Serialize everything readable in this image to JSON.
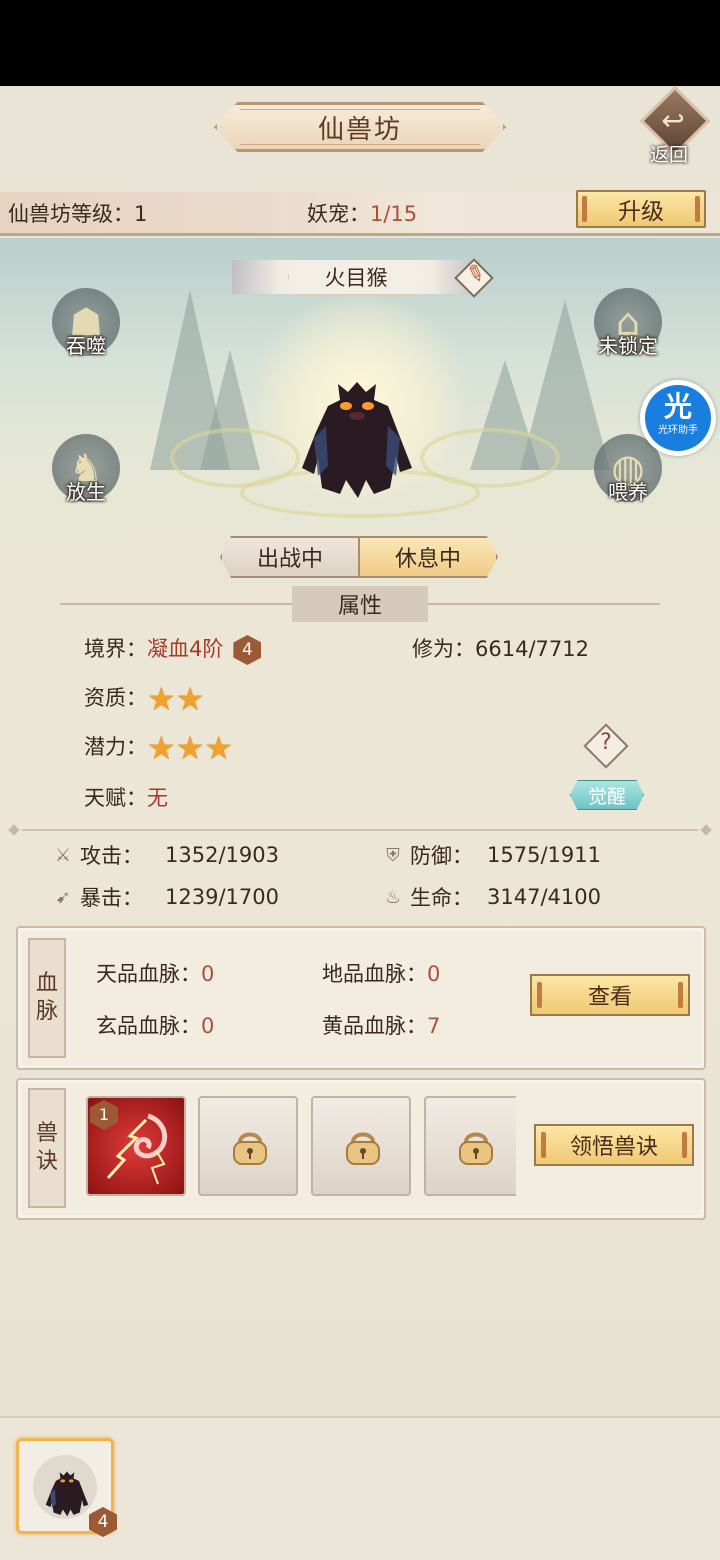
{
  "header": {
    "title": "仙兽坊",
    "back_label": "返回"
  },
  "info": {
    "level_label": "仙兽坊等级：1",
    "pet_label": "妖宠：",
    "pet_value": "1/15",
    "upgrade_label": "升级"
  },
  "pet": {
    "name": "火目猴",
    "actions": {
      "devour": "吞噬",
      "release": "放生",
      "lock": "未锁定",
      "feed": "喂养"
    },
    "status": {
      "battle": "出战中",
      "resting": "休息中",
      "selected": "休息中"
    }
  },
  "helper": {
    "big": "光",
    "small": "光环助手"
  },
  "attributes": {
    "section_title": "属性",
    "realm_label": "境界：",
    "realm_value": "凝血4阶",
    "realm_badge": "4",
    "cultivation_label": "修为：",
    "cultivation_value": "6614/7712",
    "aptitude_label": "资质：",
    "aptitude_stars": 2,
    "potential_label": "潜力：",
    "potential_stars": 3,
    "talent_label": "天赋：",
    "talent_value": "无",
    "help_icon": "?",
    "awaken_label": "觉醒"
  },
  "stats": {
    "attack_label": "攻击：",
    "attack_value": "1352/1903",
    "defense_label": "防御：",
    "defense_value": "1575/1911",
    "crit_label": "暴击：",
    "crit_value": "1239/1700",
    "hp_label": "生命：",
    "hp_value": "3147/4100"
  },
  "bloodline": {
    "tag_1": "血",
    "tag_2": "脉",
    "heaven_label": "天品血脉：",
    "heaven_value": "0",
    "earth_label": "地品血脉：",
    "earth_value": "0",
    "mystic_label": "玄品血脉：",
    "mystic_value": "0",
    "yellow_label": "黄品血脉：",
    "yellow_value": "7",
    "view_label": "查看"
  },
  "skills": {
    "tag_1": "兽",
    "tag_2": "诀",
    "skill_level": "1",
    "learn_label": "领悟兽诀"
  },
  "roster": {
    "pet_level": "4"
  },
  "colors": {
    "accent_red": "#a63b2a",
    "gold_button": "#f0c874",
    "badge_brown": "#9c5a34",
    "helper_blue": "#1a7ee0"
  }
}
